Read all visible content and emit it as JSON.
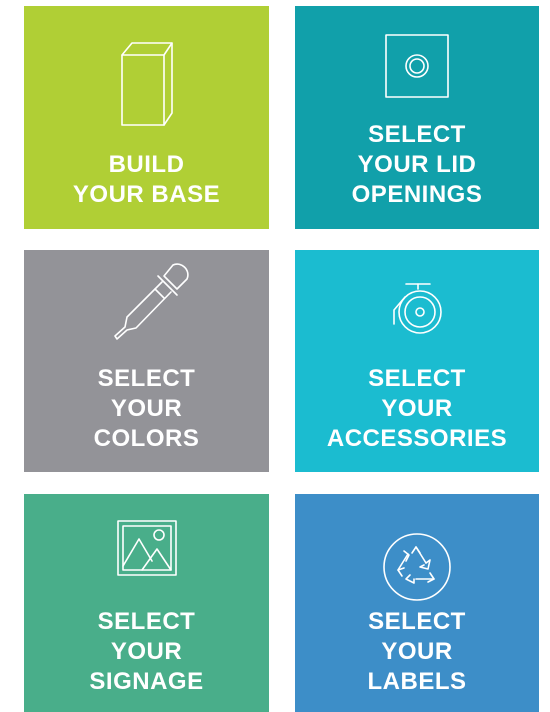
{
  "tiles": [
    {
      "id": "build-base",
      "lines": [
        "BUILD",
        "YOUR BASE"
      ],
      "icon": "box-icon",
      "color": "#b0cf35"
    },
    {
      "id": "lid-openings",
      "lines": [
        "SELECT",
        "YOUR LID",
        "OPENINGS"
      ],
      "icon": "lid-opening-icon",
      "color": "#11a0aa"
    },
    {
      "id": "colors",
      "lines": [
        "SELECT",
        "YOUR",
        "COLORS"
      ],
      "icon": "eyedropper-icon",
      "color": "#939398"
    },
    {
      "id": "accessories",
      "lines": [
        "SELECT",
        "YOUR",
        "ACCESSORIES"
      ],
      "icon": "caster-wheel-icon",
      "color": "#1bbcd0"
    },
    {
      "id": "signage",
      "lines": [
        "SELECT",
        "YOUR",
        "SIGNAGE"
      ],
      "icon": "image-icon",
      "color": "#49ae8a"
    },
    {
      "id": "labels",
      "lines": [
        "SELECT",
        "YOUR",
        "LABELS"
      ],
      "icon": "recycle-icon",
      "color": "#3d8ec8"
    }
  ]
}
